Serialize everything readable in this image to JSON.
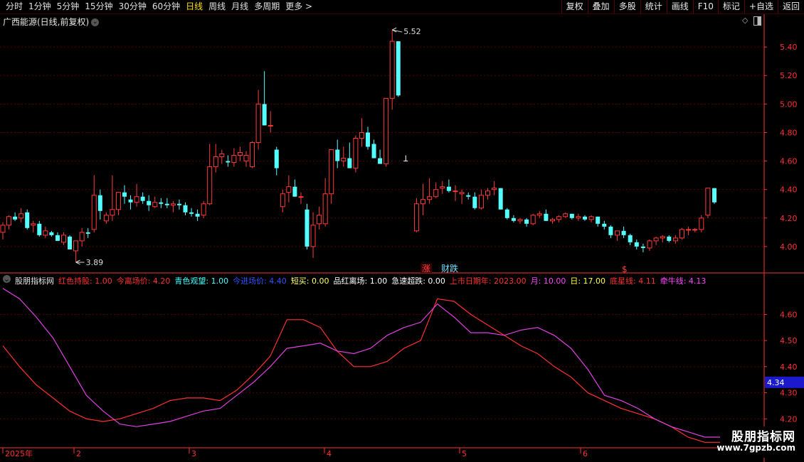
{
  "toolbar": {
    "left": [
      "分时",
      "1分钟",
      "5分钟",
      "15分钟",
      "30分钟",
      "60分钟",
      "日线",
      "周线",
      "月线",
      "多周期",
      "更多 >"
    ],
    "active_index": 6,
    "right": [
      "复权",
      "叠加",
      "多股",
      "统计",
      "画线",
      "F10",
      "标记",
      "+自选",
      "返回"
    ]
  },
  "title": "广西能源(日线,前复权)",
  "price_axis": [
    "5.40",
    "5.20",
    "5.00",
    "4.80",
    "4.60",
    "4.40",
    "4.20",
    "4.00"
  ],
  "annotations": {
    "high_label": "5.52",
    "low_label": "3.89",
    "mark_zhang": "涨",
    "mark_caidie": "财跌",
    "mark_dollar": "$"
  },
  "indicator": {
    "name": "股朋指标网",
    "params": [
      {
        "label": "红色持股: 1.00",
        "color": "#ff3030"
      },
      {
        "label": "今离场价: 4.20",
        "color": "#ff3030"
      },
      {
        "label": "青色观望: 1.00",
        "color": "#44ffff"
      },
      {
        "label": "今进场价: 4.40",
        "color": "#3050ff"
      },
      {
        "label": "短买: 0.00",
        "color": "#ffff66"
      },
      {
        "label": "品红离场: 1.00",
        "color": "#ffffff"
      },
      {
        "label": "急速超跌: 0.00",
        "color": "#ffffff"
      },
      {
        "label": "上市日期年: 2023.00",
        "color": "#ff3030"
      },
      {
        "label": "月: 10.00",
        "color": "#ff44ff"
      },
      {
        "label": "日: 17.00",
        "color": "#ffff44"
      },
      {
        "label": "底星线: 4.11",
        "color": "#ff3030"
      },
      {
        "label": "牵牛线: 4.13",
        "color": "#ff44ff"
      }
    ],
    "axis": [
      "4.60",
      "4.50",
      "4.40",
      "4.30",
      "4.20"
    ],
    "current_value": "4.34"
  },
  "date_axis": [
    "2025年",
    "2",
    "3",
    "4",
    "5",
    "6"
  ],
  "watermark": {
    "line1": "股朋指标网",
    "line2": "www.7gpzb.com"
  },
  "colors": {
    "up": "#ff3a3a",
    "down": "#54ffff",
    "grid": "#5a0000",
    "axis": "#ff3030",
    "magenta": "#e040e0"
  },
  "chart_data": {
    "type": "candlestick",
    "candles": [
      [
        4.1,
        4.17,
        4.05,
        4.15
      ],
      [
        4.15,
        4.22,
        4.12,
        4.21
      ],
      [
        4.21,
        4.24,
        4.18,
        4.19
      ],
      [
        4.2,
        4.27,
        4.17,
        4.23
      ],
      [
        4.24,
        4.26,
        4.12,
        4.13
      ],
      [
        4.15,
        4.18,
        4.1,
        4.16
      ],
      [
        4.16,
        4.18,
        4.07,
        4.08
      ],
      [
        4.08,
        4.14,
        4.06,
        4.11
      ],
      [
        4.1,
        4.11,
        4.07,
        4.08
      ],
      [
        4.08,
        4.1,
        4.04,
        4.04
      ],
      [
        4.03,
        4.1,
        4.01,
        4.08
      ],
      [
        4.07,
        4.08,
        4.0,
        3.98
      ],
      [
        3.97,
        4.04,
        3.89,
        4.04
      ],
      [
        4.04,
        4.13,
        4.0,
        4.1
      ],
      [
        4.1,
        4.13,
        4.06,
        4.09
      ],
      [
        4.12,
        4.5,
        4.1,
        4.36
      ],
      [
        4.36,
        4.4,
        4.19,
        4.25
      ],
      [
        4.18,
        4.24,
        4.16,
        4.22
      ],
      [
        4.22,
        4.5,
        4.18,
        4.26
      ],
      [
        4.26,
        4.36,
        4.22,
        4.38
      ],
      [
        4.38,
        4.43,
        4.3,
        4.35
      ],
      [
        4.33,
        4.36,
        4.26,
        4.31
      ],
      [
        4.31,
        4.44,
        4.28,
        4.35
      ],
      [
        4.35,
        4.38,
        4.3,
        4.32
      ],
      [
        4.32,
        4.36,
        4.25,
        4.29
      ],
      [
        4.28,
        4.35,
        4.27,
        4.31
      ],
      [
        4.31,
        4.34,
        4.27,
        4.3
      ],
      [
        4.3,
        4.34,
        4.27,
        4.29
      ],
      [
        4.29,
        4.32,
        4.24,
        4.3
      ],
      [
        4.3,
        4.33,
        4.26,
        4.29
      ],
      [
        4.29,
        4.31,
        4.22,
        4.24
      ],
      [
        4.24,
        4.27,
        4.21,
        4.23
      ],
      [
        4.23,
        4.26,
        4.18,
        4.21
      ],
      [
        4.22,
        4.32,
        4.2,
        4.3
      ],
      [
        4.3,
        4.72,
        4.29,
        4.56
      ],
      [
        4.56,
        4.72,
        4.52,
        4.63
      ],
      [
        4.63,
        4.68,
        4.58,
        4.65
      ],
      [
        4.6,
        4.64,
        4.56,
        4.59
      ],
      [
        4.59,
        4.69,
        4.56,
        4.64
      ],
      [
        4.64,
        4.7,
        4.6,
        4.66
      ],
      [
        4.6,
        4.67,
        4.56,
        4.64
      ],
      [
        4.56,
        4.74,
        4.55,
        4.73
      ],
      [
        4.73,
        5.1,
        4.68,
        5.0
      ],
      [
        5.0,
        5.23,
        4.9,
        4.85
      ],
      [
        4.85,
        4.95,
        4.8,
        4.85
      ],
      [
        4.68,
        4.7,
        4.5,
        4.55
      ],
      [
        4.28,
        4.4,
        4.24,
        4.37
      ],
      [
        4.38,
        4.5,
        4.31,
        4.42
      ],
      [
        4.42,
        4.47,
        4.38,
        4.35
      ],
      [
        4.35,
        4.38,
        4.3,
        4.35
      ],
      [
        4.26,
        4.3,
        3.98,
        4.0
      ],
      [
        4.0,
        4.24,
        3.92,
        4.15
      ],
      [
        4.16,
        4.28,
        4.12,
        4.22
      ],
      [
        4.16,
        4.48,
        4.14,
        4.37
      ],
      [
        4.37,
        4.68,
        4.3,
        4.68
      ],
      [
        4.68,
        4.75,
        4.55,
        4.6
      ],
      [
        4.6,
        4.7,
        4.56,
        4.62
      ],
      [
        4.62,
        4.73,
        4.58,
        4.55
      ],
      [
        4.55,
        4.78,
        4.52,
        4.76
      ],
      [
        4.76,
        4.9,
        4.7,
        4.8
      ],
      [
        4.8,
        4.84,
        4.68,
        4.7
      ],
      [
        4.72,
        4.75,
        4.63,
        4.62
      ],
      [
        4.62,
        4.68,
        4.58,
        4.58
      ],
      [
        4.58,
        5.04,
        4.56,
        5.04
      ],
      [
        5.04,
        5.52,
        4.96,
        5.44
      ],
      [
        5.44,
        5.41,
        5.05,
        5.06
      ]
    ],
    "candles_after_gap": [
      [
        4.11,
        4.34,
        4.1,
        4.3
      ],
      [
        4.3,
        4.44,
        4.22,
        4.33
      ],
      [
        4.33,
        4.48,
        4.3,
        4.35
      ],
      [
        4.35,
        4.45,
        4.34,
        4.4
      ],
      [
        4.41,
        4.46,
        4.37,
        4.42
      ],
      [
        4.42,
        4.47,
        4.38,
        4.39
      ],
      [
        4.39,
        4.43,
        4.32,
        4.39
      ],
      [
        4.37,
        4.4,
        4.3,
        4.38
      ],
      [
        4.36,
        4.38,
        4.33,
        4.35
      ],
      [
        4.35,
        4.38,
        4.26,
        4.27
      ],
      [
        4.27,
        4.4,
        4.26,
        4.36
      ],
      [
        4.36,
        4.41,
        4.33,
        4.39
      ],
      [
        4.4,
        4.46,
        4.36,
        4.41
      ],
      [
        4.41,
        4.4,
        4.26,
        4.26
      ],
      [
        4.26,
        4.27,
        4.19,
        4.2
      ],
      [
        4.2,
        4.22,
        4.17,
        4.18
      ],
      [
        4.18,
        4.2,
        4.16,
        4.19
      ],
      [
        4.19,
        4.2,
        4.14,
        4.16
      ],
      [
        4.16,
        4.23,
        4.15,
        4.22
      ],
      [
        4.22,
        4.25,
        4.2,
        4.23
      ],
      [
        4.23,
        4.26,
        4.2,
        4.18
      ],
      [
        4.18,
        4.2,
        4.16,
        4.19
      ],
      [
        4.19,
        4.22,
        4.17,
        4.21
      ],
      [
        4.21,
        4.24,
        4.2,
        4.23
      ],
      [
        4.23,
        4.22,
        4.19,
        4.2
      ],
      [
        4.2,
        4.23,
        4.18,
        4.21
      ],
      [
        4.21,
        4.22,
        4.18,
        4.19
      ],
      [
        4.19,
        4.22,
        4.17,
        4.21
      ],
      [
        4.21,
        4.2,
        4.14,
        4.16
      ],
      [
        4.16,
        4.18,
        4.12,
        4.14
      ],
      [
        4.14,
        4.15,
        4.06,
        4.08
      ],
      [
        4.08,
        4.11,
        4.04,
        4.11
      ],
      [
        4.11,
        4.14,
        4.06,
        4.08
      ],
      [
        4.08,
        4.09,
        4.01,
        4.03
      ],
      [
        4.03,
        4.05,
        3.98,
        4.0
      ],
      [
        4.0,
        4.02,
        3.96,
        3.99
      ],
      [
        3.99,
        4.05,
        3.97,
        4.04
      ],
      [
        4.04,
        4.07,
        4.01,
        4.06
      ],
      [
        4.06,
        4.08,
        4.03,
        4.07
      ],
      [
        4.07,
        4.08,
        4.03,
        4.04
      ],
      [
        4.04,
        4.08,
        4.02,
        4.06
      ],
      [
        4.06,
        4.13,
        4.05,
        4.12
      ],
      [
        4.12,
        4.14,
        4.08,
        4.12
      ],
      [
        4.12,
        4.13,
        4.1,
        4.12
      ],
      [
        4.12,
        4.22,
        4.1,
        4.2
      ],
      [
        4.22,
        4.41,
        4.2,
        4.41
      ],
      [
        4.41,
        4.41,
        4.3,
        4.31
      ]
    ],
    "series": [
      {
        "name": "底星线",
        "color": "#ff3030",
        "values": [
          4.48,
          4.4,
          4.33,
          4.28,
          4.23,
          4.2,
          4.19,
          4.2,
          4.22,
          4.24,
          4.27,
          4.28,
          4.28,
          4.27,
          4.31,
          4.37,
          4.44,
          4.58,
          4.58,
          4.55,
          4.46,
          4.4,
          4.4,
          4.42,
          4.47,
          4.5,
          4.66,
          4.65,
          4.6,
          4.56,
          4.52,
          4.48,
          4.45,
          4.4,
          4.36,
          4.3,
          4.27,
          4.24,
          4.22,
          4.2,
          4.17,
          4.13,
          4.11,
          4.11
        ]
      },
      {
        "name": "牵牛线",
        "color": "#e040e0",
        "values": [
          4.7,
          4.66,
          4.59,
          4.51,
          4.4,
          4.29,
          4.23,
          4.18,
          4.17,
          4.18,
          4.19,
          4.21,
          4.23,
          4.24,
          4.29,
          4.34,
          4.4,
          4.47,
          4.48,
          4.49,
          4.46,
          4.45,
          4.47,
          4.52,
          4.55,
          4.57,
          4.64,
          4.59,
          4.53,
          4.53,
          4.52,
          4.54,
          4.55,
          4.52,
          4.47,
          4.39,
          4.29,
          4.27,
          4.24,
          4.2,
          4.17,
          4.15,
          4.13,
          4.13
        ]
      }
    ],
    "ylim_main": [
      3.82,
      5.62
    ],
    "ylim_indicator": [
      4.1,
      4.74
    ]
  }
}
